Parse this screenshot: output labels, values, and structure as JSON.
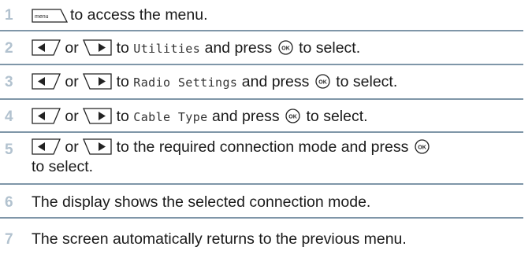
{
  "steps": [
    {
      "num": "1",
      "text": "to access the menu."
    },
    {
      "num": "2",
      "or": "or",
      "to": "to",
      "target": "Utilities",
      "press": "and press",
      "select": "to select."
    },
    {
      "num": "3",
      "or": "or",
      "to": "to",
      "target": "Radio Settings",
      "press": "and press",
      "select": "to select."
    },
    {
      "num": "4",
      "or": "or",
      "to": "to",
      "target": "Cable Type",
      "press": "and press",
      "select": "to select."
    },
    {
      "num": "5",
      "or": "or",
      "text": "to the required connection mode and press",
      "select": "to select."
    },
    {
      "num": "6",
      "text": "The display shows the selected connection mode."
    },
    {
      "num": "7",
      "text": "The screen automatically returns to the previous menu."
    }
  ],
  "icons": {
    "menu_key": "menu-key-icon",
    "nav_left": "nav-left-key-icon",
    "nav_right": "nav-right-key-icon",
    "ok_key": "ok-key-icon",
    "menu_key_label": "menu"
  },
  "colors": {
    "step_number": "#b2c2cf",
    "divider": "#7f96a8",
    "text": "#1a1a1a"
  }
}
